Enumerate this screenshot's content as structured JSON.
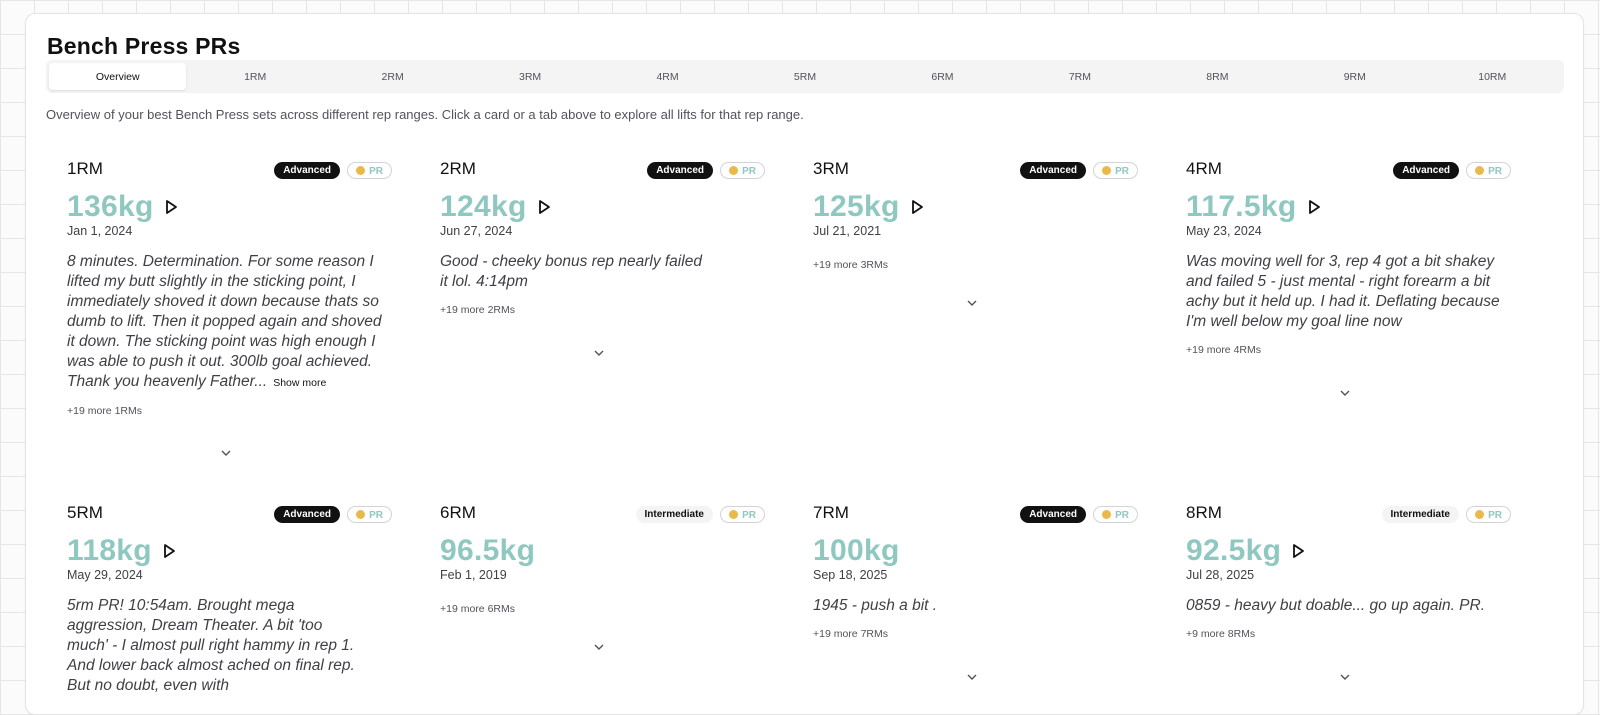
{
  "page": {
    "title": "Bench Press PRs",
    "description": "Overview of your best Bench Press sets across different rep ranges. Click a card or a tab above to explore all lifts for that rep range."
  },
  "tabs": [
    {
      "label": "Overview"
    },
    {
      "label": "1RM"
    },
    {
      "label": "2RM"
    },
    {
      "label": "3RM"
    },
    {
      "label": "4RM"
    },
    {
      "label": "5RM"
    },
    {
      "label": "6RM"
    },
    {
      "label": "7RM"
    },
    {
      "label": "8RM"
    },
    {
      "label": "9RM"
    },
    {
      "label": "10RM"
    }
  ],
  "pr_badge": "PR",
  "show_more": "Show more",
  "colors": {
    "weight": "#8fc8c0",
    "badge_advanced": "#111111",
    "badge_intermediate": "#f4f4f5",
    "medal": "#e9b949"
  },
  "cards": [
    {
      "rm": "1RM",
      "level": "Advanced",
      "weight": "136kg",
      "date": "Jan 1, 2024",
      "note": "8 minutes. Determination. For some reason I lifted my butt slightly in the sticking point, I immediately shoved it down because thats so dumb to lift. Then it popped again and shoved it down. The sticking point was high enough I was able to push it out. 300lb goal achieved. Thank you heavenly Father...",
      "more": "+19 more 1RMs",
      "icon": "play-icon"
    },
    {
      "rm": "2RM",
      "level": "Advanced",
      "weight": "124kg",
      "date": "Jun 27, 2024",
      "note": "Good - cheeky bonus rep nearly failed it lol. 4:14pm",
      "more": "+19 more 2RMs",
      "icon": "play-icon"
    },
    {
      "rm": "3RM",
      "level": "Advanced",
      "weight": "125kg",
      "date": "Jul 21, 2021",
      "note": "",
      "more": "+19 more 3RMs",
      "icon": "play-icon"
    },
    {
      "rm": "4RM",
      "level": "Advanced",
      "weight": "117.5kg",
      "date": "May 23, 2024",
      "note": "Was moving well for 3, rep 4 got a bit shakey and failed 5 - just mental - right forearm a bit achy but it held up. I had it. Deflating because I'm well below my goal line now",
      "more": "+19 more 4RMs",
      "icon": "play-icon"
    },
    {
      "rm": "5RM",
      "level": "Advanced",
      "weight": "118kg",
      "date": "May 29, 2024",
      "note": "5rm PR! 10:54am. Brought mega aggression, Dream Theater. A bit 'too much' - I almost pull right hammy in rep 1. And lower back almost ached on final rep. But no doubt, even with",
      "more": "",
      "icon": "play-icon"
    },
    {
      "rm": "6RM",
      "level": "Intermediate",
      "weight": "96.5kg",
      "date": "Feb 1, 2019",
      "note": "",
      "more": "+19 more 6RMs",
      "icon": ""
    },
    {
      "rm": "7RM",
      "level": "Advanced",
      "weight": "100kg",
      "date": "Sep 18, 2025",
      "note": "1945 - push a bit .",
      "more": "+19 more 7RMs",
      "icon": ""
    },
    {
      "rm": "8RM",
      "level": "Intermediate",
      "weight": "92.5kg",
      "date": "Jul 28, 2025",
      "note": "0859 - heavy but doable... go up again. PR.",
      "more": "+9 more 8RMs",
      "icon": "play-icon"
    }
  ]
}
